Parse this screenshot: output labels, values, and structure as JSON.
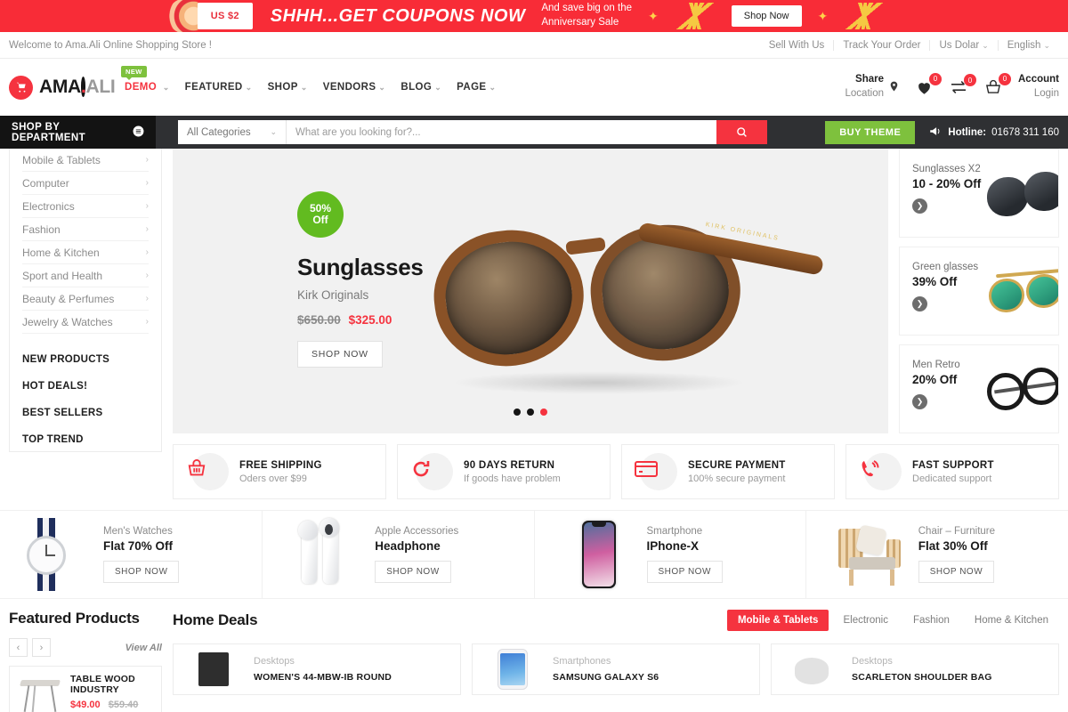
{
  "promo": {
    "coupon": "US $2",
    "headline": "SHHH...GET COUPONS NOW",
    "sub_line1": "And save big on the",
    "sub_line2": "Anniversary Sale",
    "button": "Shop Now"
  },
  "topbar": {
    "welcome": "Welcome to Ama.Ali Online Shopping Store !",
    "links": [
      "Sell With Us",
      "Track Your Order"
    ],
    "currency": "Us Dolar",
    "language": "English"
  },
  "header": {
    "logo": {
      "bold": "AMA",
      "dot": ".",
      "light": "ALI",
      "icon": "cart-icon"
    },
    "nav": [
      {
        "label": "DEMO",
        "badge": "NEW",
        "active": true
      },
      {
        "label": "FEATURED",
        "active": false
      },
      {
        "label": "SHOP",
        "active": false
      },
      {
        "label": "VENDORS",
        "active": false
      },
      {
        "label": "BLOG",
        "active": false
      },
      {
        "label": "PAGE",
        "active": false
      }
    ],
    "share": {
      "t1": "Share",
      "t2": "Location",
      "icon": "map-pin-icon"
    },
    "wishlist": {
      "count": "0",
      "icon": "heart-icon"
    },
    "compare": {
      "count": "0",
      "icon": "compare-icon"
    },
    "cart": {
      "count": "0",
      "icon": "basket-icon"
    },
    "account": {
      "t1": "Account",
      "t2": "Login"
    }
  },
  "search": {
    "department_button": "SHOP BY DEPARTMENT",
    "category_selected": "All Categories",
    "placeholder": "What are you looking for?...",
    "value": "",
    "buy_theme": "BUY THEME",
    "hotline_label": "Hotline:",
    "hotline_number": "01678 311 160"
  },
  "sidebar": {
    "categories": [
      "Mobile & Tablets",
      "Computer",
      "Electronics",
      "Fashion",
      "Home & Kitchen",
      "Sport and Health",
      "Beauty & Perfumes",
      "Jewelry & Watches"
    ],
    "links": [
      "NEW PRODUCTS",
      "HOT DEALS!",
      "BEST SELLERS",
      "TOP TREND"
    ]
  },
  "slider": {
    "discount_line1": "50%",
    "discount_line2": "Off",
    "title": "Sunglasses",
    "subtitle": "Kirk Originals",
    "price_old": "$650.00",
    "price_new": "$325.00",
    "button": "SHOP NOW",
    "brand_engraving": "KIRK ORIGINALS",
    "dots": [
      {
        "active": false
      },
      {
        "active": false
      },
      {
        "active": true
      }
    ]
  },
  "promo_cards": [
    {
      "sub": "Sunglasses X2",
      "title": "10 - 20% Off",
      "art": "dark-sunglasses"
    },
    {
      "sub": "Green glasses",
      "title": "39% Off",
      "art": "green-aviators"
    },
    {
      "sub": "Men Retro",
      "title": "20% Off",
      "art": "retro-round-glasses"
    }
  ],
  "services": [
    {
      "title": "FREE SHIPPING",
      "sub": "Oders over $99",
      "icon": "basket-icon"
    },
    {
      "title": "90 DAYS RETURN",
      "sub": "If goods have problem",
      "icon": "refresh-icon"
    },
    {
      "title": "SECURE PAYMENT",
      "sub": "100% secure payment",
      "icon": "credit-card-icon"
    },
    {
      "title": "FAST SUPPORT",
      "sub": "Dedicated support",
      "icon": "phone-ring-icon"
    }
  ],
  "banners": [
    {
      "sub": "Men's Watches",
      "title": "Flat 70% Off",
      "button": "SHOP NOW",
      "art": "wrist-watch"
    },
    {
      "sub": "Apple Accessories",
      "title": "Headphone",
      "button": "SHOP NOW",
      "art": "airpods"
    },
    {
      "sub": "Smartphone",
      "title": "IPhone-X",
      "button": "SHOP NOW",
      "art": "iphone-x"
    },
    {
      "sub": "Chair – Furniture",
      "title": "Flat 30% Off",
      "button": "SHOP NOW",
      "art": "wooden-chair"
    }
  ],
  "featured": {
    "title": "Featured Products",
    "view_all": "View All",
    "prev": "‹",
    "next": "›",
    "product": {
      "name": "TABLE WOOD INDUSTRY",
      "price": "$49.00",
      "price_old": "$59.40"
    }
  },
  "deals": {
    "title": "Home Deals",
    "tabs": [
      {
        "label": "Mobile & Tablets",
        "active": true
      },
      {
        "label": "Electronic",
        "active": false
      },
      {
        "label": "Fashion",
        "active": false
      },
      {
        "label": "Home & Kitchen",
        "active": false
      }
    ],
    "cards": [
      {
        "sub": "Desktops",
        "name": "WOMEN'S 44-MBW-IB ROUND",
        "art": "black-box"
      },
      {
        "sub": "Smartphones",
        "name": "SAMSUNG GALAXY S6",
        "art": "samsung-phone"
      },
      {
        "sub": "Desktops",
        "name": "SCARLETON SHOULDER BAG",
        "art": "shoulder-bag"
      }
    ]
  },
  "colors": {
    "brand_red": "#f5333f",
    "green": "#7ec13d",
    "dark": "#2f3033"
  }
}
